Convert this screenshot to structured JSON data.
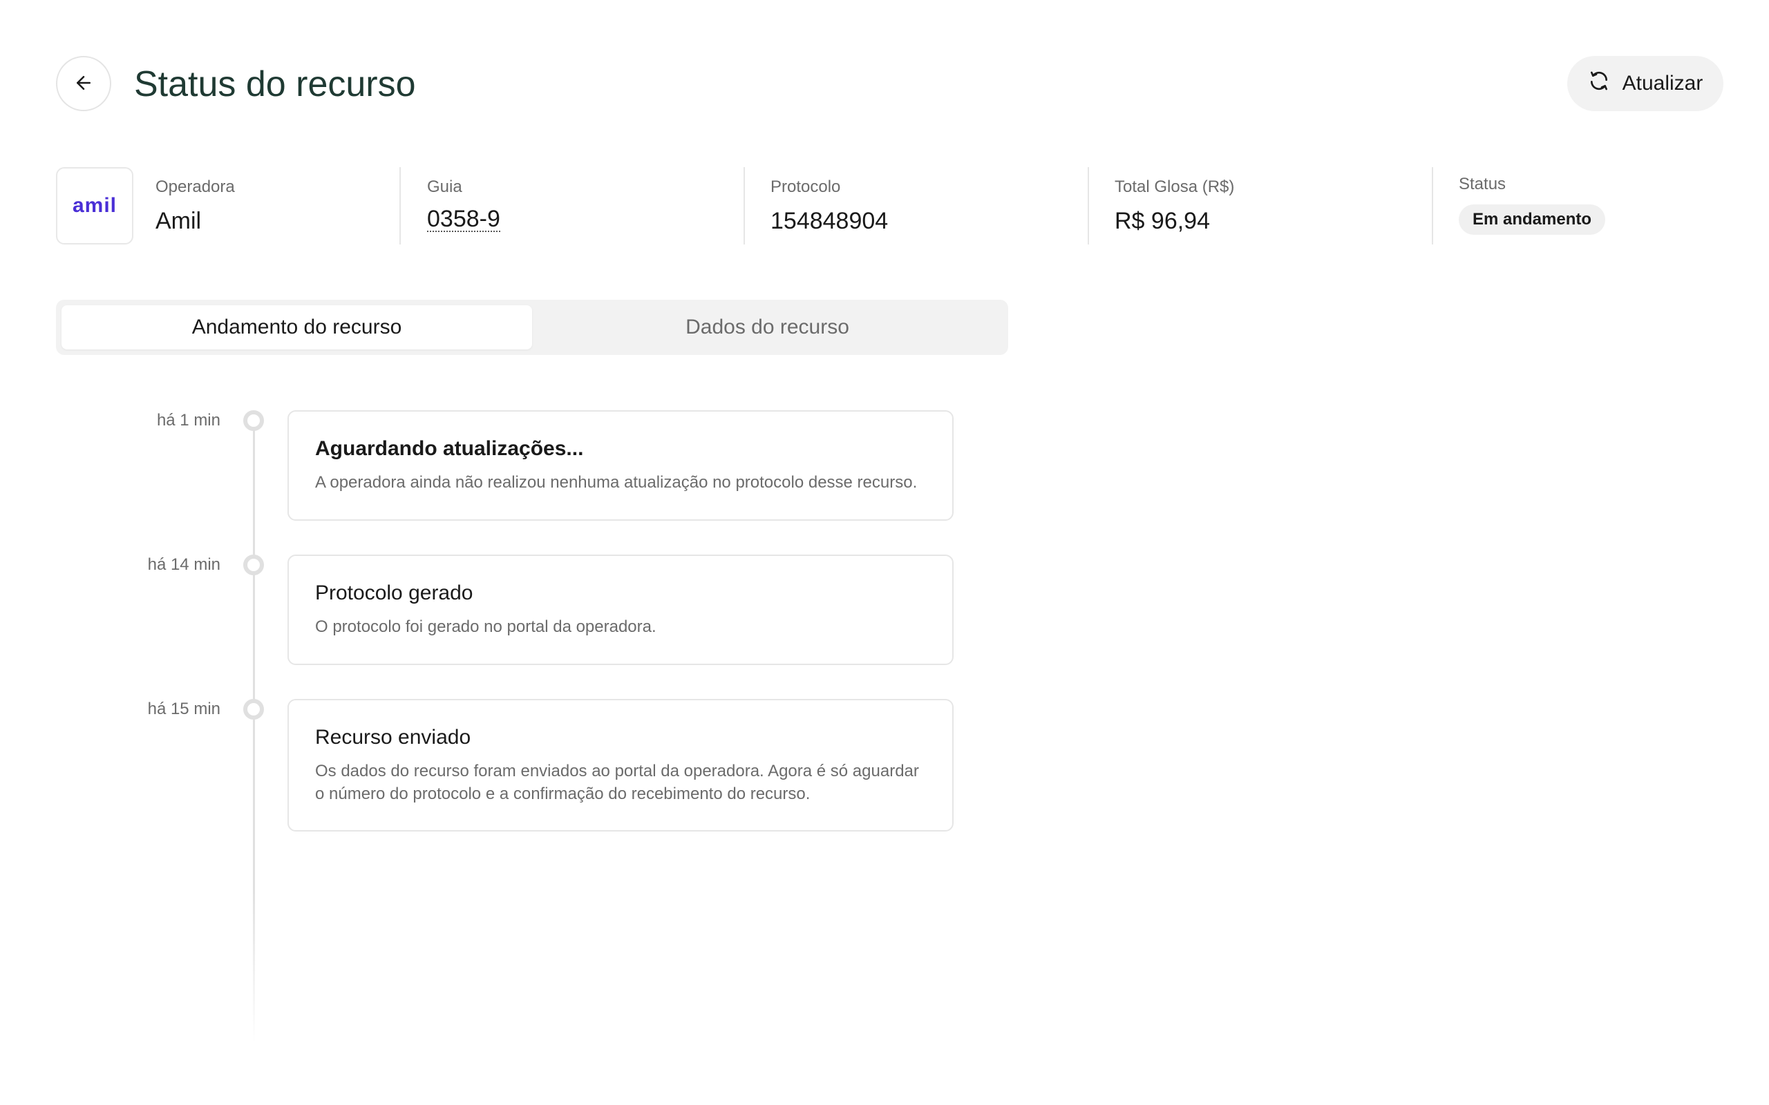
{
  "header": {
    "title": "Status do recurso",
    "refresh_label": "Atualizar"
  },
  "info": {
    "logo_text": "amil",
    "operadora_label": "Operadora",
    "operadora_value": "Amil",
    "guia_label": "Guia",
    "guia_value": "0358-9",
    "protocolo_label": "Protocolo",
    "protocolo_value": "154848904",
    "glosa_label": "Total Glosa (R$)",
    "glosa_value": "R$ 96,94",
    "status_label": "Status",
    "status_value": "Em andamento"
  },
  "tabs": [
    {
      "label": "Andamento do recurso",
      "active": true
    },
    {
      "label": "Dados do recurso",
      "active": false
    }
  ],
  "timeline": [
    {
      "time": "há 1 min",
      "title": "Aguardando atualizações...",
      "description": "A operadora ainda não realizou nenhuma atualização no protocolo desse recurso."
    },
    {
      "time": "há 14 min",
      "title": "Protocolo gerado",
      "description": "O protocolo foi gerado no portal da operadora."
    },
    {
      "time": "há 15 min",
      "title": "Recurso enviado",
      "description": "Os dados do recurso foram enviados ao portal da operadora. Agora é só aguardar o número do protocolo e a confirmação do recebimento do recurso."
    }
  ],
  "colors": {
    "title": "#1f3a33",
    "logo": "#4a2fd6"
  }
}
